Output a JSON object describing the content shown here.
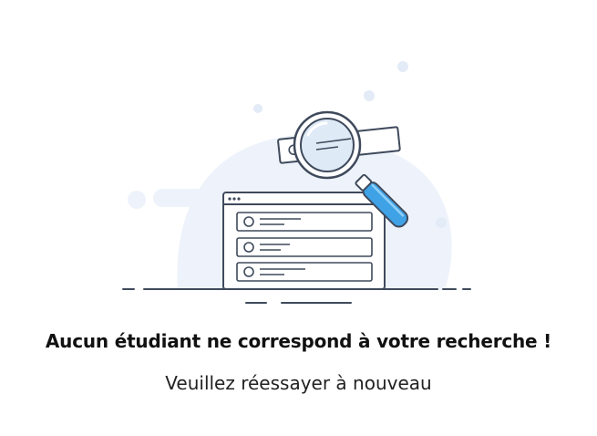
{
  "empty_state": {
    "title": "Aucun étudiant ne correspond à votre recherche !",
    "subtitle": "Veuillez réessayer à nouveau",
    "illustration_icon": "search-no-results-illustration"
  },
  "colors": {
    "background": "#ffffff",
    "blob": "#eef3fb",
    "dot": "#e6edf8",
    "line": "#3f4a5c",
    "magnifier_handle": "#3fa2e6",
    "magnifier_lens": "#dfeaf7",
    "title_text": "#111111",
    "subtitle_text": "#222222"
  }
}
